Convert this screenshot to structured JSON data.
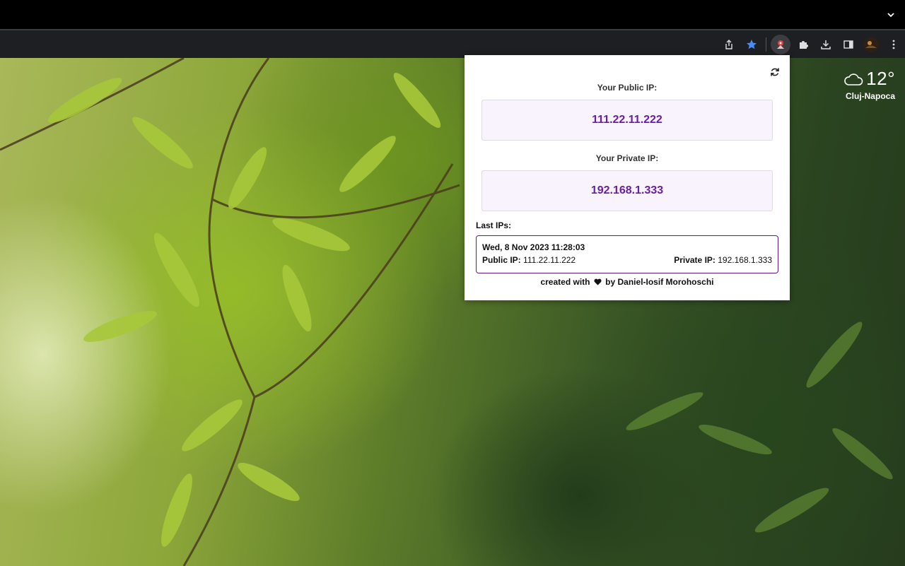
{
  "browser": {
    "toolbar_icons": [
      {
        "name": "share-icon"
      },
      {
        "name": "bookmark-star-icon",
        "color": "#4c8bf5"
      },
      {
        "name": "ip-extension-icon",
        "active": true
      },
      {
        "name": "extensions-puzzle-icon"
      },
      {
        "name": "download-icon"
      },
      {
        "name": "side-panel-icon"
      },
      {
        "name": "profile-avatar"
      },
      {
        "name": "more-menu-icon"
      }
    ],
    "tab_strip_menu": "chevron-down-icon"
  },
  "weather": {
    "icon": "cloud-icon",
    "temperature": "12°",
    "city": "Cluj-Napoca"
  },
  "popup": {
    "refresh_icon": "refresh-icon",
    "public_label": "Your Public IP:",
    "public_ip": "111.22.11.222",
    "private_label": "Your Private IP:",
    "private_ip": "192.168.1.333",
    "last_label": "Last IPs:",
    "history": [
      {
        "date": "Wed, 8 Nov 2023 11:28:03",
        "public_label": "Public IP:",
        "public_ip": "111.22.11.222",
        "private_label": "Private IP:",
        "private_ip": "192.168.1.333"
      }
    ],
    "credit_prefix": "created with",
    "credit_suffix": "by Daniel-Iosif Morohoschi",
    "accent_color": "#6a1fa3",
    "box_background": "#f8f3fd"
  }
}
